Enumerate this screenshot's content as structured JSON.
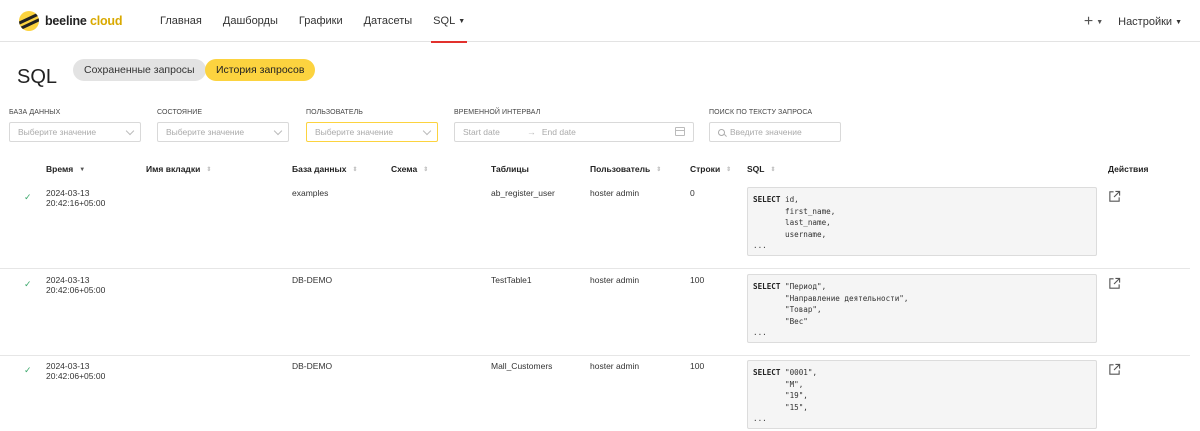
{
  "brand": {
    "name": "beeline",
    "suffix": "cloud"
  },
  "nav": {
    "items": [
      {
        "label": "Главная"
      },
      {
        "label": "Дашборды"
      },
      {
        "label": "Графики"
      },
      {
        "label": "Датасеты"
      },
      {
        "label": "SQL"
      }
    ],
    "plus": "+",
    "settings": "Настройки"
  },
  "page": {
    "title": "SQL",
    "tabs": {
      "saved": "Сохраненные запросы",
      "history": "История запросов"
    }
  },
  "filters": {
    "database": {
      "label": "База данных",
      "placeholder": "Выберите значение"
    },
    "state": {
      "label": "Состояние",
      "placeholder": "Выберите значение"
    },
    "user": {
      "label": "Пользователь",
      "placeholder": "Выберите значение"
    },
    "interval": {
      "label": "Временной интервал",
      "start": "Start date",
      "arrow": "→",
      "end": "End date"
    },
    "search": {
      "label": "Поиск по тексту запроса",
      "placeholder": "Введите значение"
    }
  },
  "table": {
    "headers": {
      "time": "Время",
      "tab_name": "Имя вкладки",
      "database": "База данных",
      "schema": "Схема",
      "tables": "Таблицы",
      "user": "Пользователь",
      "rows": "Строки",
      "sql": "SQL",
      "actions": "Действия"
    },
    "rows": [
      {
        "status": "✓",
        "date": "2024-03-13",
        "time": "20:42:16+05:00",
        "database": "examples",
        "tables": "ab_register_user",
        "user": "hoster admin",
        "rows": "0",
        "sql_kw": "SELECT",
        "sql_rest": " id,\n       first_name,\n       last_name,\n       username,\n..."
      },
      {
        "status": "✓",
        "date": "2024-03-13",
        "time": "20:42:06+05:00",
        "database": "DB-DEMO",
        "tables": "TestTable1",
        "user": "hoster admin",
        "rows": "100",
        "sql_kw": "SELECT",
        "sql_rest": " \"Период\",\n       \"Направление деятельности\",\n       \"Товар\",\n       \"Вес\"\n..."
      },
      {
        "status": "✓",
        "date": "2024-03-13",
        "time": "20:42:06+05:00",
        "database": "DB-DEMO",
        "tables": "Mall_Customers",
        "user": "hoster admin",
        "rows": "100",
        "sql_kw": "SELECT",
        "sql_rest": " \"0001\",\n       \"M\",\n       \"19\",\n       \"15\",\n..."
      }
    ]
  },
  "colors": {
    "accent": "#fcd33f",
    "active_underline": "#e2312d",
    "success": "#3ba86b"
  }
}
